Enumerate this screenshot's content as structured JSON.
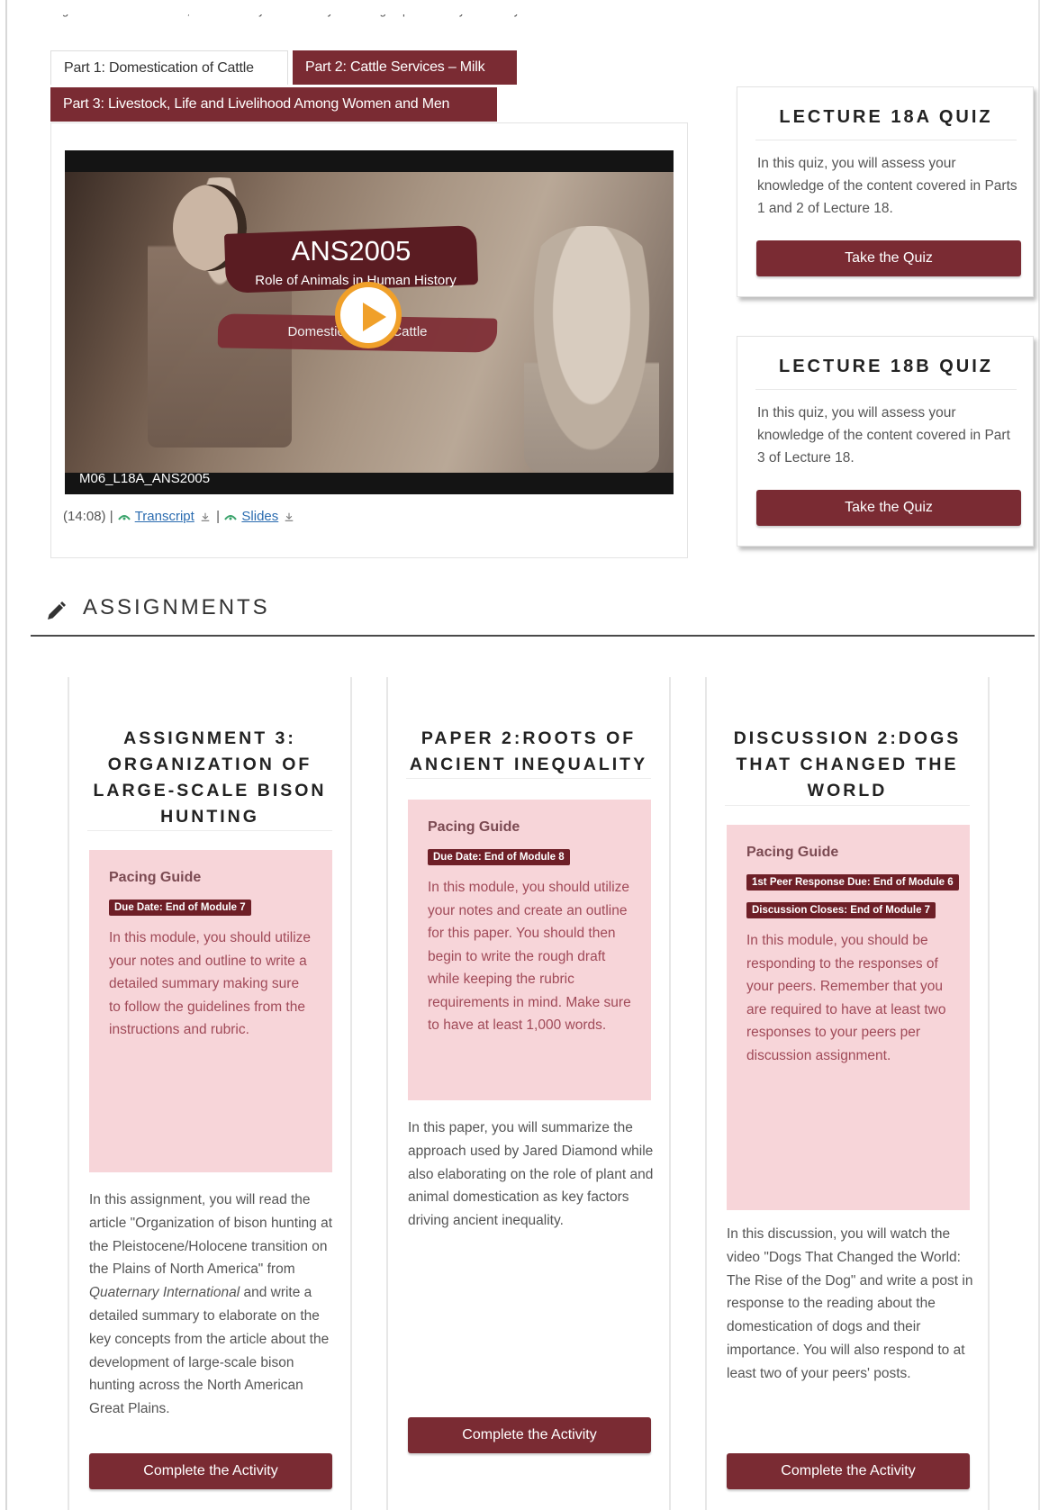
{
  "top_cut_text": "origin of lactose tolerance, and the likely evolutionary advantages provided by the ability to consume fresh milk.",
  "tabs": [
    {
      "label": "Part 1: Domestication of Cattle"
    },
    {
      "label": "Part 2: Cattle Services – Milk"
    },
    {
      "label": "Part 3: Livestock, Life and Livelihood Among Women and Men"
    }
  ],
  "video": {
    "course_code": "ANS2005",
    "course_title": "Role of Animals in Human History",
    "lecture_title": "Domestication of Cattle",
    "video_id": "M06_L18A_ANS2005",
    "duration": "(14:08)",
    "sep1": "|",
    "transcript_label": "Transcript",
    "sep2": "|",
    "slides_label": "Slides"
  },
  "quizzes": [
    {
      "title": "LECTURE 18A QUIZ",
      "description": "In this quiz, you will assess your knowledge of the content covered in Parts 1 and 2 of Lecture 18.",
      "button": "Take the Quiz"
    },
    {
      "title": "LECTURE 18B QUIZ",
      "description": "In this quiz, you will assess your knowledge of the content covered in Part 3 of Lecture 18.",
      "button": "Take the Quiz"
    }
  ],
  "assignments_heading": "ASSIGNMENTS",
  "assignments": [
    {
      "title": "ASSIGNMENT 3: ORGANIZATION OF LARGE-SCALE BISON HUNTING",
      "pacing_label": "Pacing Guide",
      "badges": [
        "Due Date: End of Module 7"
      ],
      "pacing_text": "In this module, you should utilize your notes and outline to write a detailed summary making sure to follow the guidelines from the instructions and rubric.",
      "desc_part1": "In this assignment, you will read the article \"Organization of bison hunting at the Pleistocene/Holocene transition on the Plains of North America\" from ",
      "desc_italic": "Quaternary International",
      "desc_part2": " and write a detailed summary to elaborate on the key concepts from the article about the development of large-scale bison hunting across the North American Great Plains.",
      "button": "Complete the Activity"
    },
    {
      "title": "PAPER 2:ROOTS OF ANCIENT INEQUALITY",
      "pacing_label": "Pacing Guide",
      "badges": [
        "Due Date: End of Module 8"
      ],
      "pacing_text": "In this module, you should utilize your notes and create an outline for this paper. You should then begin to write the rough draft while keeping the rubric requirements in mind. Make sure to have at least 1,000 words.",
      "desc_part1": "In this paper, you will summarize the approach used by Jared Diamond while also elaborating on the role of plant and animal domestication as key factors driving ancient inequality.",
      "button": "Complete the Activity"
    },
    {
      "title": "DISCUSSION 2:DOGS THAT CHANGED THE WORLD",
      "pacing_label": "Pacing Guide",
      "badges": [
        "1st Peer Response Due: End of Module 6",
        "Discussion Closes: End of Module 7"
      ],
      "pacing_text": "In this module, you should be responding to the responses of your peers. Remember that you are required to have at least two responses to your peers per discussion assignment.",
      "desc_part1": "In this discussion, you will watch the video \"Dogs That Changed the World: The Rise of the Dog\" and write a post in response to the reading about the domestication of dogs and their importance. You will also respond to at least two of your peers' posts.",
      "button": "Complete the Activity"
    }
  ],
  "colors": {
    "brand": "#7a2b33",
    "badge": "#6e1f27",
    "pacing_bg": "#f7d5d9",
    "link": "#2b6cb0",
    "play_accent": "#f0a02a"
  }
}
